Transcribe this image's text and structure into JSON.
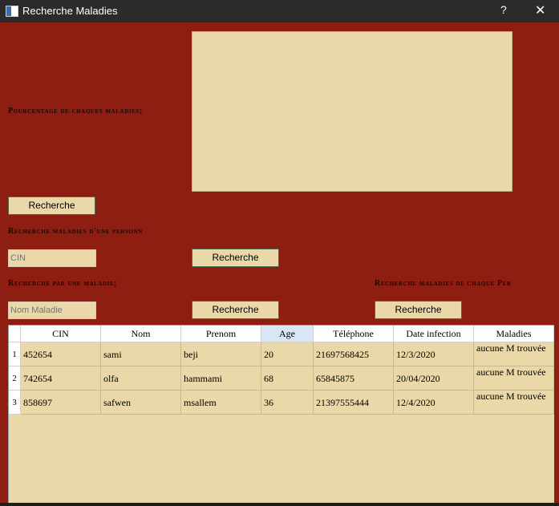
{
  "window": {
    "title": "Recherche Maladies",
    "help": "?",
    "close": "✕"
  },
  "labels": {
    "pourcentage": "Pourcentage de chaques maladies;",
    "recherche_personne": "Recherche maladies d'une personn",
    "recherche_maladie": "Recherche par une maladie;",
    "recherche_chaque": "Recherche maladies de chaque Per"
  },
  "buttons": {
    "recherche1": "Recherche",
    "recherche2": "Recherche",
    "recherche3": "Recherche",
    "recherche4": "Recherche"
  },
  "inputs": {
    "cin": {
      "placeholder": "CIN",
      "value": ""
    },
    "nom_maladie": {
      "placeholder": "Nom Maladie",
      "value": ""
    }
  },
  "table": {
    "columns": [
      "CIN",
      "Nom",
      "Prenom",
      "Age",
      "Téléphone",
      "Date infection",
      "Maladies"
    ],
    "rows": [
      {
        "num": "1",
        "cells": [
          "452654",
          "sami",
          "beji",
          "20",
          "21697568425",
          "12/3/2020",
          "aucune M trouvée"
        ]
      },
      {
        "num": "2",
        "cells": [
          "742654",
          "olfa",
          "hammami",
          "68",
          "65845875",
          "20/04/2020",
          "aucune M trouvée"
        ]
      },
      {
        "num": "3",
        "cells": [
          "858697",
          "safwen",
          "msallem",
          "36",
          "21397555444",
          "12/4/2020",
          "aucune M trouvée"
        ]
      }
    ]
  }
}
